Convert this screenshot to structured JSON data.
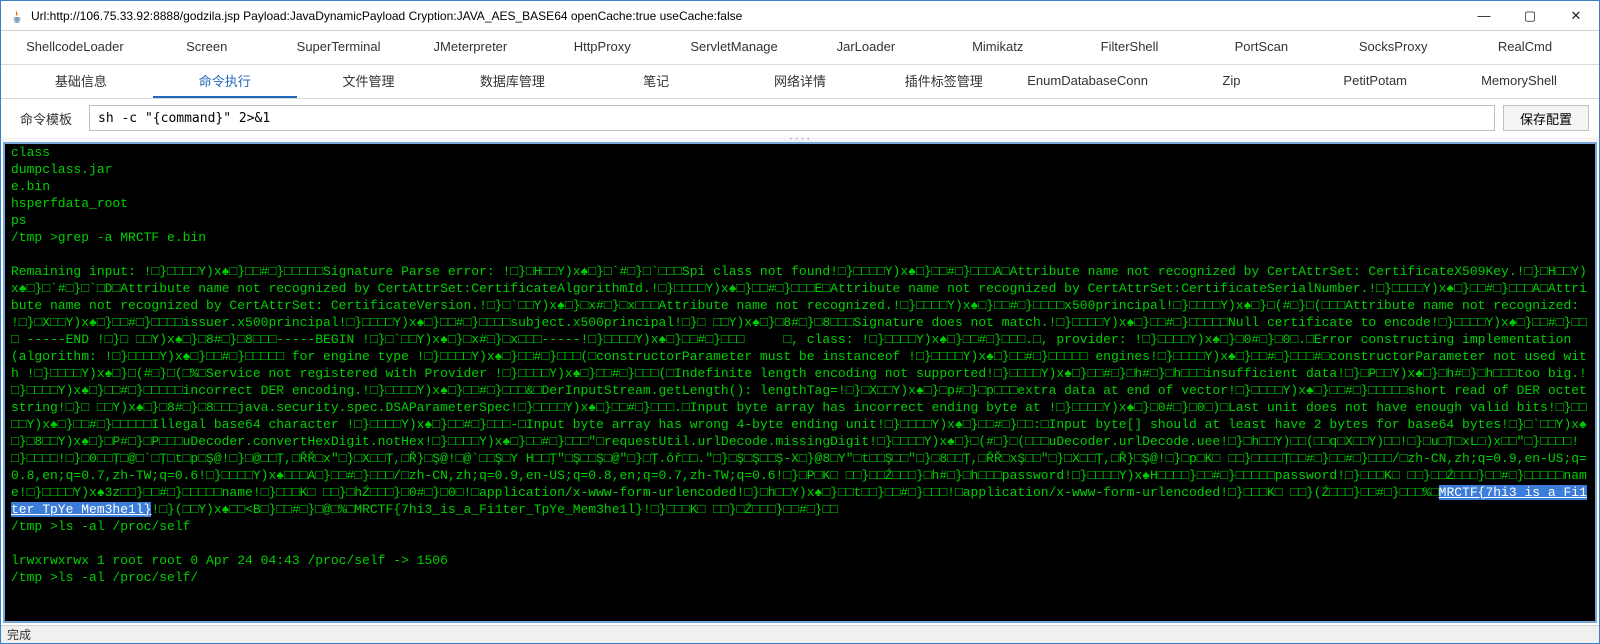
{
  "window": {
    "title": "Url:http://106.75.33.92:8888/godzila.jsp Payload:JavaDynamicPayload Cryption:JAVA_AES_BASE64 openCache:true useCache:false",
    "icon_name": "java-icon"
  },
  "win_controls": {
    "min": "—",
    "max": "▢",
    "close": "✕"
  },
  "tabs_row1": [
    "ShellcodeLoader",
    "Screen",
    "SuperTerminal",
    "JMeterpreter",
    "HttpProxy",
    "ServletManage",
    "JarLoader",
    "Mimikatz",
    "FilterShell",
    "PortScan",
    "SocksProxy",
    "RealCmd"
  ],
  "tabs_row2": [
    "基础信息",
    "命令执行",
    "文件管理",
    "数据库管理",
    "笔记",
    "网络详情",
    "插件标签管理",
    "EnumDatabaseConn",
    "Zip",
    "PetitPotam",
    "MemoryShell"
  ],
  "tabs_row2_active_index": 1,
  "cmd": {
    "label": "命令模板",
    "value": "sh -c \"{command}\" 2>&1",
    "save_label": "保存配置"
  },
  "terminal": {
    "pre_lines": [
      "class",
      "dumpclass.jar",
      "e.bin",
      "hsperfdata_root",
      "ps",
      "/tmp >grep -a MRCTF e.bin",
      ""
    ],
    "body": "Remaining input: !□}□□□□Y)x♠□}□□#□}□□□□□Signature Parse error: !□}□H□□Y)x♠□}□`#□}□`□□□Spi class not found!□}□□□□Y)x♠□}□□#□}□□□A□Attribute name not recognized by CertAttrSet: CertificateX509Key.!□}□H□□Y)x♠□}□`#□}□`□D□Attribute name not recognized by CertAttrSet:CertificateAlgorithmId.!□}□□□□Y)x♠□}□□#□}□□□E□Attribute name not recognized by CertAttrSet:CertificateSerialNumber.!□}□□□□Y)x♠□}□□#□}□□□A□Attribute name not recognized by CertAttrSet: CertificateVersion.!□}□`□□Y)x♠□}□x#□}□x□□□Attribute name not recognized.!□}□□□□Y)x♠□}□□#□}□□□□x500principal!□}□□□□Y)x♠□}□(#□}□(□□□Attribute name not recognized: !□}□X□□Y)x♠□}□□#□}□□□□issuer.x500principal!□}□□□□Y)x♠□}□□#□}□□□□subject.x500principal!□}□ □□Y)x♠□}□8#□}□8□□□Signature does not match.!□}□□□□Y)x♠□}□□#□}□□□□□Null certificate to encode!□}□□□□Y)x♠□}□□#□}□□□ -----END !□}□ □□Y)x♠□}□8#□}□8□□□-----BEGIN !□}□`□□Y)x♠□}□x#□}□x□□□-----!□}□□□□Y)x♠□}□□#□}□□□     □, class: !□}□□□□Y)x♠□}□□#□}□□□.□, provider: !□}□□□□Y)x♠□}□0#□}□0□.□Error constructing implementation (algorithm: !□}□□□□Y)x♠□}□□#□}□□□□□ for engine type !□}□□□□Y)x♠□}□□#□}□□□(□constructorParameter must be instanceof !□}□□□□Y)x♠□}□□#□}□□□□□ engines!□}□□□□Y)x♠□}□□#□}□□□#□constructorParameter not used with !□}□□□□Y)x♠□}□(#□}□(□%□Service not registered with Provider !□}□□□□Y)x♠□}□□#□}□□□(□Indefinite length encoding not supported!□}□□□□Y)x♠□}□□#□}□h#□}□h□□□insufficient data!□}□P□□Y)x♠□}□h#□}□h□□□too big.!□}□□□□Y)x♠□}□□#□}□□□□□incorrect DER encoding.!□}□□□□Y)x♠□}□□#□}□□□&□DerInputStream.getLength(): lengthTag=!□}□X□□Y)x♠□}□p#□}□p□□□extra data at end of vector!□}□□□□Y)x♠□}□□#□}□□□□□short read of DER octet string!□}□ □□Y)x♠□}□8#□}□8□□□java.security.spec.DSAParameterSpec!□}□□□□Y)x♠□}□□#□}□□□.□Input byte array has incorrect ending byte at !□}□□□□Y)x♠□}□0#□}□0□)□Last unit does not have enough valid bits!□}□□□□Y)x♠□}□□#□}□□□□□Illegal base64 character !□}□□□□Y)x♠□}□□#□}□□□-□Input byte array has wrong 4-byte ending unit!□}□□□□Y)x♠□}□□#□}□□:□Input byte[] should at least have 2 bytes for base64 bytes!□}□`□□Y)x♠□}□8□□Y)x♠□}□P#□}□P□□□uDecoder.convertHexDigit.notHex!□}□□□□Y)x♠□}□□#□}□□□\"□requestUtil.urlDecode.missingDigit!□}□□□□Y)x♠□}□(#□}□(□□□uDecoder.urlDecode.uee!□}□h□□Y)□□(□□q□X□□Y)□□!□}□u□Ţ□xL□)x□□\"□}□□□□!□}□□□□!□}□0□□Ţ□@□`□Ţ□t□p□Ş@!□}□@□□Ţ,□ŘŘ□x\"□}□X□□Ţ,□Ř}□Ş@!□@`□□Ş□Y H□□Ţ\"□Ş□□Ş□@\"□}□Ţ.ǒř□□.\"□}□Ş□Ş□□Ş-X□}@8□Y\"□t□□Ş□□\"□}□8□□Ţ,□ŘŘ□xŞ□□\"□}□X□□Ţ,□Ř}□Ş@!□}□p□K□ □□}□□□□Ţ□□#□}□□#□}□□□/□zh-CN,zh;q=0.9,en-US;q=0.8,en;q=0.7,zh-TW;q=0.6!□}□□□□Y)x♠□□□A□}□□#□}□□□/□zh-CN,zh;q=0.9,en-US;q=0.8,en;q=0.7,zh-TW;q=0.6!□}□P□K□ □□}□□Ź□□□}□h#□}□h□□□password!□}□□□□Y)x♠H□□□□}□□#□}□□□□□password!□}□□□K□ □□}□□Ź□□□}□□#□}□□□□□name!□}□□□□Y)x♠3z□□}□□#□}□□□□□name!□}□□□K□ □□}□hŹ□□□}□0#□}□0□!□application/x-www-form-urlencoded!□}□h□□Y)x♠□}□□t□□}□□#□}□□□!□application/x-www-form-urlencoded!□}□□□K□ □□}(Ź□□□}□□#□}□□□%□",
    "flag": "MRCTF{7hi3_is_a_Fi1ter_TpYe_Mem3he1l}",
    "after_flag": "!□}(□□Y)x♠□□<B□}□□#□}□@□%□MRCTF{7hi3_is_a_Fi1ter_TpYe_Mem3he1l}!□}□□□K□ □□}□Ź□□□}□□#□}□□",
    "post_lines": [
      "/tmp >ls -al /proc/self",
      "",
      "lrwxrwxrwx 1 root root 0 Apr 24 04:43 /proc/self -> 1506",
      "/tmp >ls -al /proc/self/"
    ]
  },
  "statusbar": {
    "text": "完成"
  }
}
